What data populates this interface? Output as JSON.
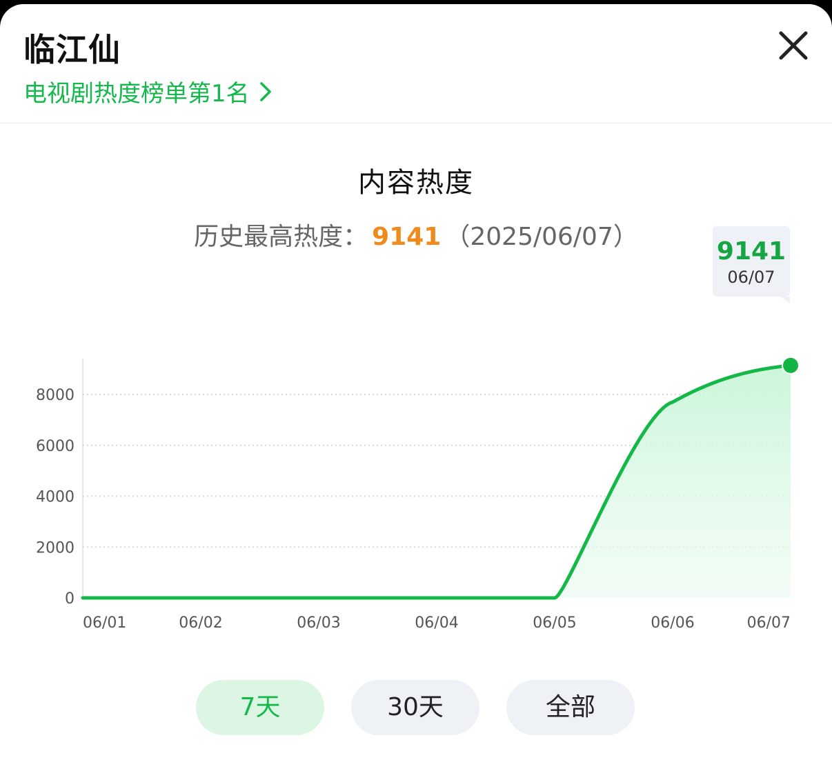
{
  "header": {
    "title": "临江仙",
    "rank_text": "电视剧热度榜单第1名"
  },
  "chart_header": {
    "title": "内容热度",
    "peak_label": "历史最高热度：",
    "peak_value": "9141",
    "peak_date": "（2025/06/07）"
  },
  "tooltip": {
    "value": "9141",
    "date": "06/07"
  },
  "chart_data": {
    "type": "area",
    "x": [
      "06/01",
      "06/02",
      "06/03",
      "06/04",
      "06/05",
      "06/06",
      "06/07"
    ],
    "series": [
      {
        "values": [
          0,
          0,
          0,
          0,
          0,
          7700,
          9141
        ]
      }
    ],
    "ylim": [
      0,
      8000
    ],
    "yticks": [
      "0",
      "2000",
      "4000",
      "6000",
      "8000"
    ],
    "grid": true,
    "line_color": "#14b849",
    "fill_color": "#d6f7e2"
  },
  "tabs": [
    {
      "label": "7天",
      "active": true
    },
    {
      "label": "30天",
      "active": false
    },
    {
      "label": "全部",
      "active": false
    }
  ]
}
